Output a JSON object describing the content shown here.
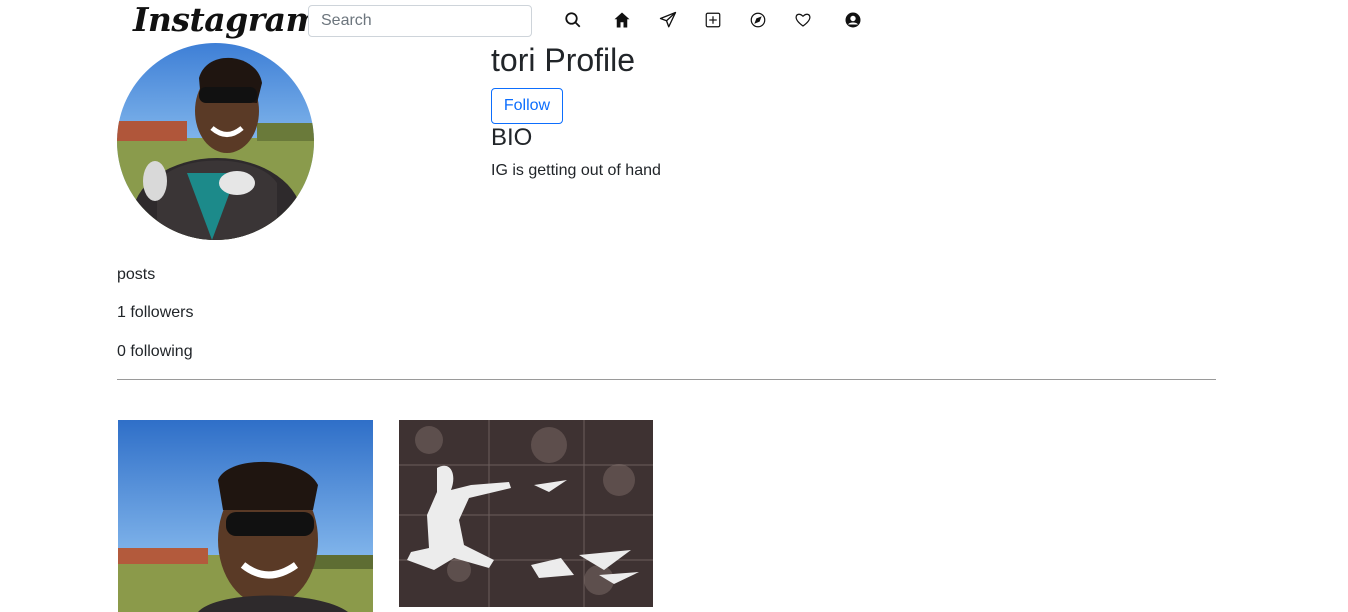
{
  "navbar": {
    "logo": "Instagram",
    "search_placeholder": "Search",
    "icons": [
      "search-icon",
      "home-icon",
      "send-icon",
      "add-post-icon",
      "explore-icon",
      "heart-icon",
      "profile-icon"
    ]
  },
  "profile": {
    "username": "tori Profile",
    "follow_label": "Follow",
    "bio_title": "BIO",
    "bio_text": "IG is getting out of hand",
    "posts_label": "posts",
    "followers_label": "1 followers",
    "following_label": "0 following"
  },
  "posts": [
    {
      "description": "selfie photo"
    },
    {
      "description": "mural artwork photo"
    }
  ],
  "colors": {
    "accent": "#0d6efd",
    "text": "#212529",
    "divider": "#9a9a9a"
  }
}
